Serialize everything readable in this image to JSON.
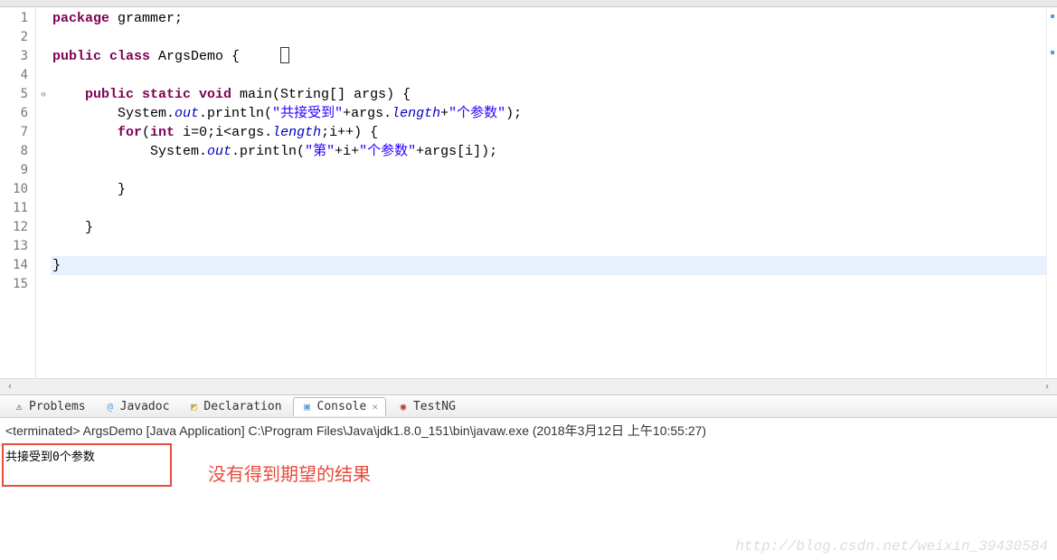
{
  "editor": {
    "lines": [
      {
        "n": "1",
        "tokens": [
          {
            "t": "package ",
            "c": "kw"
          },
          {
            "t": "grammer;",
            "c": "plain"
          }
        ]
      },
      {
        "n": "2",
        "tokens": []
      },
      {
        "n": "3",
        "tokens": [
          {
            "t": "public class ",
            "c": "kw"
          },
          {
            "t": "ArgsDemo {",
            "c": "plain"
          }
        ],
        "cursor": true
      },
      {
        "n": "4",
        "tokens": []
      },
      {
        "n": "5",
        "tokens": [
          {
            "t": "    ",
            "c": "plain"
          },
          {
            "t": "public static void ",
            "c": "kw"
          },
          {
            "t": "main(String[] args) {",
            "c": "plain"
          }
        ],
        "marker": "⊖"
      },
      {
        "n": "6",
        "tokens": [
          {
            "t": "        System.",
            "c": "plain"
          },
          {
            "t": "out",
            "c": "fld"
          },
          {
            "t": ".println(",
            "c": "plain"
          },
          {
            "t": "\"共接受到\"",
            "c": "str"
          },
          {
            "t": "+args.",
            "c": "plain"
          },
          {
            "t": "length",
            "c": "fld"
          },
          {
            "t": "+",
            "c": "plain"
          },
          {
            "t": "\"个参数\"",
            "c": "str"
          },
          {
            "t": ");",
            "c": "plain"
          }
        ]
      },
      {
        "n": "7",
        "tokens": [
          {
            "t": "        ",
            "c": "plain"
          },
          {
            "t": "for",
            "c": "kw"
          },
          {
            "t": "(",
            "c": "plain"
          },
          {
            "t": "int ",
            "c": "kw"
          },
          {
            "t": "i=0;i<args.",
            "c": "plain"
          },
          {
            "t": "length",
            "c": "fld"
          },
          {
            "t": ";i++) {",
            "c": "plain"
          }
        ]
      },
      {
        "n": "8",
        "tokens": [
          {
            "t": "            System.",
            "c": "plain"
          },
          {
            "t": "out",
            "c": "fld"
          },
          {
            "t": ".println(",
            "c": "plain"
          },
          {
            "t": "\"第\"",
            "c": "str"
          },
          {
            "t": "+i+",
            "c": "plain"
          },
          {
            "t": "\"个参数\"",
            "c": "str"
          },
          {
            "t": "+args[i]);",
            "c": "plain"
          }
        ]
      },
      {
        "n": "9",
        "tokens": []
      },
      {
        "n": "10",
        "tokens": [
          {
            "t": "        }",
            "c": "plain"
          }
        ]
      },
      {
        "n": "11",
        "tokens": []
      },
      {
        "n": "12",
        "tokens": [
          {
            "t": "    }",
            "c": "plain"
          }
        ]
      },
      {
        "n": "13",
        "tokens": []
      },
      {
        "n": "14",
        "tokens": [
          {
            "t": "}",
            "c": "plain"
          }
        ],
        "hl": true
      },
      {
        "n": "15",
        "tokens": []
      }
    ]
  },
  "views": {
    "problems": "Problems",
    "javadoc": "Javadoc",
    "declaration": "Declaration",
    "console": "Console",
    "testng": "TestNG"
  },
  "console": {
    "header": "<terminated> ArgsDemo [Java Application] C:\\Program Files\\Java\\jdk1.8.0_151\\bin\\javaw.exe (2018年3月12日 上午10:55:27)",
    "output": "共接受到0个参数",
    "annotation": "没有得到期望的结果"
  },
  "watermark": "http://blog.csdn.net/weixin_39430584"
}
